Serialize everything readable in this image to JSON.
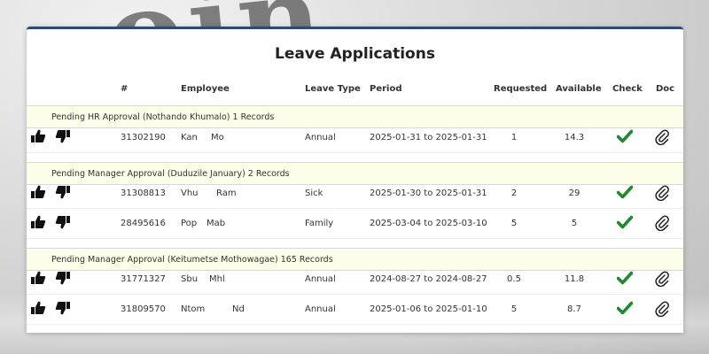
{
  "page_title": "Leave Applications",
  "columns": [
    "#",
    "Employee",
    "Leave Type",
    "Period",
    "Requested",
    "Available",
    "Check",
    "Doc"
  ],
  "groups": [
    {
      "label": "Pending HR Approval (Nothando Khumalo) 1 Records",
      "rows": [
        {
          "id": "31302190",
          "first": "Kan",
          "last": "Mo",
          "type": "Annual",
          "period": "2025-01-31 to 2025-01-31",
          "requested": "1",
          "available": "14.3"
        }
      ]
    },
    {
      "label": "Pending Manager Approval (Duduzile January) 2 Records",
      "rows": [
        {
          "id": "31308813",
          "first": "Vhu",
          "last": "Ram",
          "type": "Sick",
          "period": "2025-01-30 to 2025-01-31",
          "requested": "2",
          "available": "29"
        },
        {
          "id": "28495616",
          "first": "Pop",
          "last": "Mab",
          "type": "Family",
          "period": "2025-03-04 to 2025-03-10",
          "requested": "5",
          "available": "5"
        }
      ]
    },
    {
      "label": "Pending Manager Approval (Keitumetse Mothowagae) 165 Records",
      "rows": [
        {
          "id": "31771327",
          "first": "Sbu",
          "last": "Mhl",
          "type": "Annual",
          "period": "2024-08-27 to 2024-08-27",
          "requested": "0.5",
          "available": "11.8"
        },
        {
          "id": "31809570",
          "first": "Ntom",
          "last": "Nd",
          "type": "Annual",
          "period": "2025-01-06 to 2025-01-10",
          "requested": "5",
          "available": "8.7"
        }
      ]
    }
  ],
  "icons": {
    "approve": "thumbs-up-icon",
    "reject": "thumbs-down-icon",
    "check": "checkmark-icon",
    "doc": "paperclip-icon"
  },
  "colors": {
    "accent": "#2b4a7a",
    "check": "#1e8a2e",
    "group_bg": "#fcfde8"
  }
}
